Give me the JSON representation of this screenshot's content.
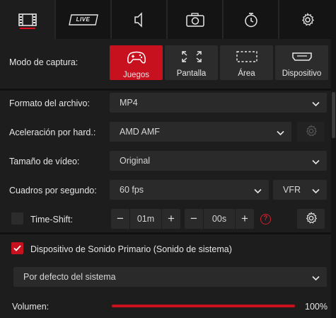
{
  "tabs": [
    {
      "icon": "film-icon",
      "active": true
    },
    {
      "icon": "live-icon",
      "label": "LIVE"
    },
    {
      "icon": "speaker-icon"
    },
    {
      "icon": "camera-icon"
    },
    {
      "icon": "stopwatch-icon"
    },
    {
      "icon": "gear-icon"
    }
  ],
  "capture": {
    "label": "Modo de captura:",
    "modes": [
      {
        "label": "Juegos",
        "icon": "gamepad-icon",
        "active": true
      },
      {
        "label": "Pantalla",
        "icon": "fullscreen-icon"
      },
      {
        "label": "Área",
        "icon": "area-select-icon"
      },
      {
        "label": "Dispositivo",
        "icon": "hdmi-device-icon"
      }
    ]
  },
  "settings": {
    "format": {
      "label": "Formato del archivo:",
      "value": "MP4"
    },
    "accel": {
      "label": "Aceleración por hard.:",
      "value": "AMD AMF"
    },
    "size": {
      "label": "Tamaño de vídeo:",
      "value": "Original"
    },
    "fps": {
      "label": "Cuadros por segundo:",
      "value": "60 fps",
      "mode": "VFR"
    },
    "timeshift": {
      "label": "Time-Shift:",
      "checked": false,
      "minutes": "01m",
      "seconds": "00s",
      "help": "?"
    }
  },
  "audio": {
    "device_label": "Dispositivo de Sonido Primario (Sonido de sistema)",
    "device_checked": true,
    "device_value": "Por defecto del sistema",
    "volume_label": "Volumen:",
    "volume_value": "100%",
    "volume_level": 1.0
  },
  "colors": {
    "accent": "#c8111f",
    "background": "#1d1d1d",
    "control": "#2a2a2a"
  }
}
